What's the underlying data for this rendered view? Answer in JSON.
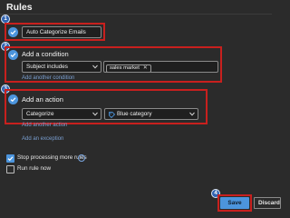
{
  "header": {
    "title": "Rules"
  },
  "step_badges": [
    "1",
    "2",
    "3",
    "4"
  ],
  "rule_name": {
    "value": "Auto Categorize Emails"
  },
  "condition": {
    "label": "Add a condition",
    "field_value": "Subject includes",
    "chip_value": "sales market",
    "chip_remove": "✕",
    "add_link": "Add another condition"
  },
  "action": {
    "label": "Add an action",
    "action_value": "Categorize",
    "category_value": "Blue category",
    "add_action_link": "Add another action",
    "add_exception_link": "Add an exception"
  },
  "options": {
    "stop_processing": {
      "label": "Stop processing more rules",
      "checked": true
    },
    "run_now": {
      "label": "Run rule now",
      "checked": false
    },
    "info_glyph": "i"
  },
  "footer": {
    "save_label": "Save",
    "discard_label": "Discard"
  },
  "colors": {
    "accent": "#4c95dd",
    "highlight": "#c8201e",
    "badge": "#2f62b0",
    "category_tag": "#4c95dd"
  }
}
